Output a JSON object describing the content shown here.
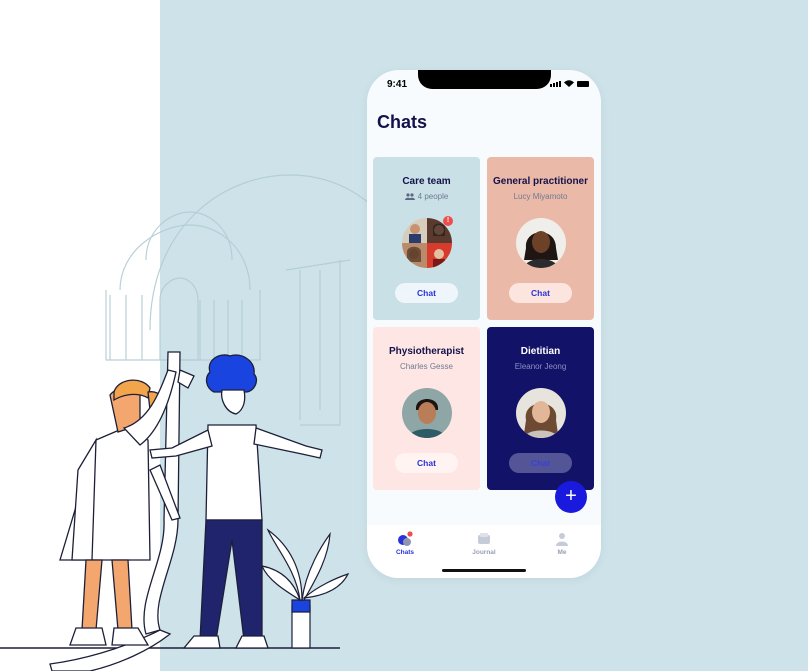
{
  "status_bar": {
    "time": "9:41"
  },
  "header": {
    "title": "Chats"
  },
  "cards": [
    {
      "title": "Care team",
      "subtitle": "4 people",
      "button": "Chat",
      "badge": "!"
    },
    {
      "title": "General practitioner",
      "subtitle": "Lucy Miyamoto",
      "button": "Chat"
    },
    {
      "title": "Physiotherapist",
      "subtitle": "Charles Gesse",
      "button": "Chat"
    },
    {
      "title": "Dietitian",
      "subtitle": "Eleanor Jeong",
      "button": "Chat"
    }
  ],
  "fab": {
    "label": "+"
  },
  "tabs": [
    {
      "label": "Chats",
      "active": true
    },
    {
      "label": "Journal",
      "active": false
    },
    {
      "label": "Me",
      "active": false
    }
  ],
  "colors": {
    "background_panel": "#cde3e9",
    "accent": "#1a1adf",
    "care_team_card": "#c8e0e6",
    "gp_card": "#eab9a8",
    "physio_card": "#fde6e3",
    "dietitian_card": "#121268"
  },
  "icons": [
    "people-icon",
    "plus-icon",
    "chats-icon",
    "journal-icon",
    "profile-icon",
    "signal-icon",
    "wifi-icon",
    "battery-icon"
  ]
}
